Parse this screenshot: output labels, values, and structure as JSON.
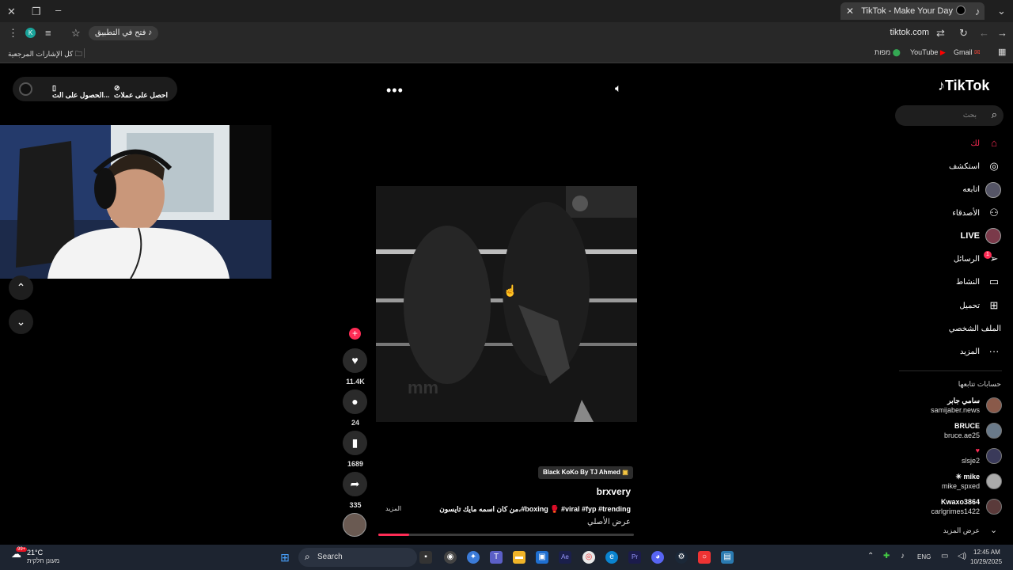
{
  "browser": {
    "tab_title": "TikTok - Make Your Day",
    "url": "tiktok.com",
    "open_in_app": "فتح في التطبيق",
    "bookmarks": {
      "all_bookmarks": "كل الإشارات المرجعية",
      "gmail": "Gmail",
      "youtube": "YouTube",
      "maps": "מפות"
    }
  },
  "top_overlay": {
    "get_coins": "احصل على عملات",
    "get_app": "الحصول على الت..."
  },
  "video": {
    "music": "Black KoKo By TJ Ahmed",
    "author": "brxvery",
    "caption": "من كان اسمه مايك تايسون،#boxing 🥊 #viral #fyp #trending",
    "more": "المزيد",
    "original": "عرض الأصلي",
    "progress_fraction": 0.12
  },
  "actions": {
    "likes": "11.4K",
    "comments": "24",
    "saves": "1689",
    "shares": "335"
  },
  "sidebar": {
    "logo": "TikTok",
    "search_placeholder": "بحث",
    "nav": [
      {
        "label": "لك",
        "icon": "home-icon"
      },
      {
        "label": "استكشف",
        "icon": "compass-icon"
      },
      {
        "label": "اتابعه",
        "icon": "avatar-icon"
      },
      {
        "label": "الأصدقاء",
        "icon": "friends-icon"
      },
      {
        "label": "LIVE",
        "icon": "live-icon"
      },
      {
        "label": "الرسائل",
        "icon": "messages-icon"
      },
      {
        "label": "النشاط",
        "icon": "activity-icon"
      },
      {
        "label": "تحميل",
        "icon": "upload-icon"
      },
      {
        "label": "الملف الشخصي",
        "icon": "profile-icon"
      },
      {
        "label": "المزيد",
        "icon": "more-icon"
      }
    ],
    "messages_badge": "1",
    "following_title": "حسابات تتابعها",
    "accounts": [
      {
        "name": "سامي جابر",
        "handle": "samijaber.news"
      },
      {
        "name": "BRUCE",
        "handle": "bruce.ae25"
      },
      {
        "name": "",
        "handle": "slsje2"
      },
      {
        "name": "mike",
        "handle": "mike_spxed"
      },
      {
        "name": "Kwaxo3864",
        "handle": "carlgrimes1422"
      }
    ],
    "see_more": "عرض المزيد"
  },
  "taskbar": {
    "weather_temp": "21°C",
    "weather_desc": "מעונן חלקית",
    "weather_badge": "99+",
    "search": "Search",
    "lang": "ENG",
    "time": "12:45 AM",
    "date": "10/29/2025"
  }
}
